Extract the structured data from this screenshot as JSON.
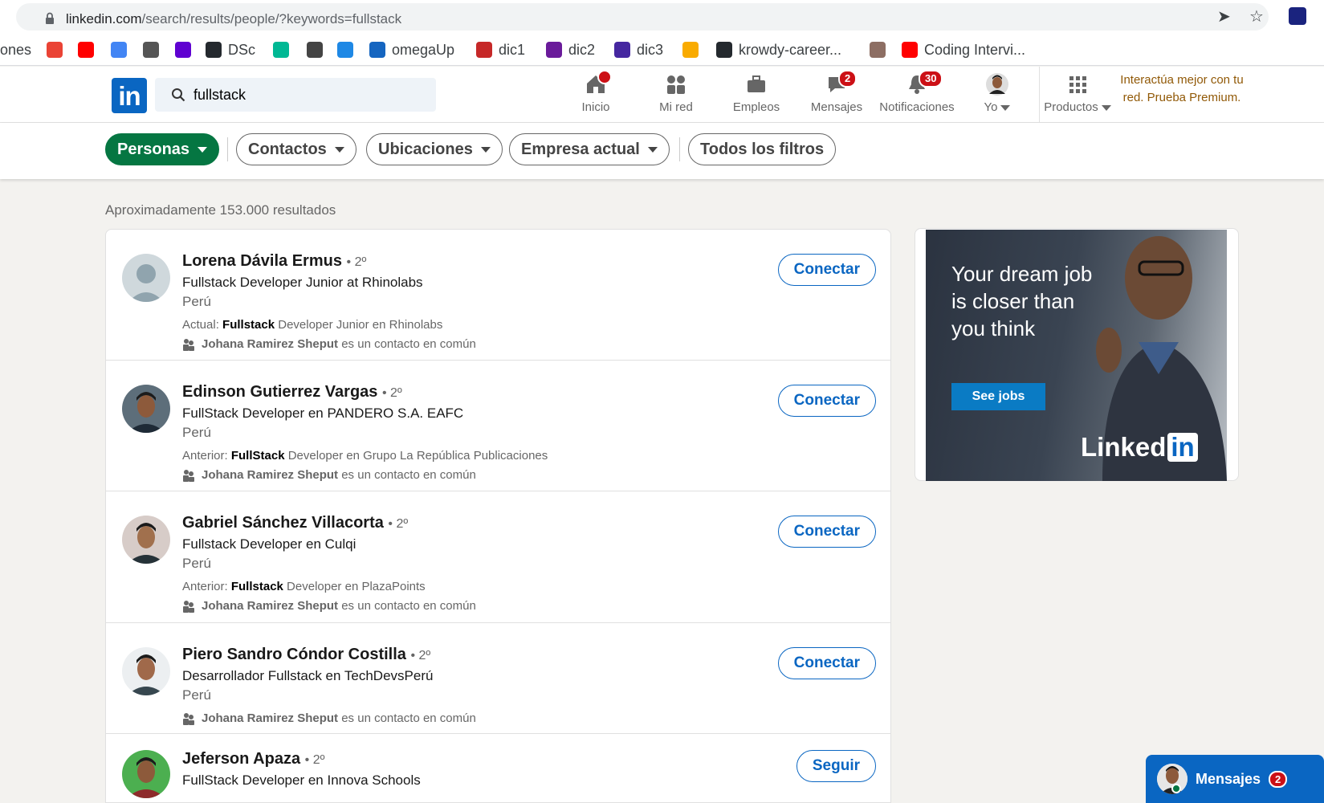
{
  "browser": {
    "url_host": "linkedin.com",
    "url_path": "/search/results/people/?keywords=fullstack",
    "bookmarks": [
      {
        "label": "ones",
        "icon": "bookmark-folder-icon",
        "color": "#ffffff"
      },
      {
        "label": "",
        "icon": "gmail-icon",
        "color": "#ea4335"
      },
      {
        "label": "",
        "icon": "youtube-icon",
        "color": "#ff0000"
      },
      {
        "label": "",
        "icon": "translate-icon",
        "color": "#4285f4"
      },
      {
        "label": "",
        "icon": "globe-icon",
        "color": "#555555"
      },
      {
        "label": "",
        "icon": "yahoo-icon",
        "color": "#5f01d1"
      },
      {
        "label": "DSc",
        "icon": "github-icon",
        "color": "#24292e"
      },
      {
        "label": "",
        "icon": "diamond-icon",
        "color": "#00b894"
      },
      {
        "label": "",
        "icon": "translate-small-icon",
        "color": "#444444"
      },
      {
        "label": "",
        "icon": "dic-icon",
        "color": "#1e88e5"
      },
      {
        "label": "omegaUp",
        "icon": "omega-icon",
        "color": "#1565c0"
      },
      {
        "label": "dic1",
        "icon": "shield-icon",
        "color": "#c62828"
      },
      {
        "label": "dic2",
        "icon": "swirl-icon",
        "color": "#6a1b9a"
      },
      {
        "label": "dic3",
        "icon": "tower-icon",
        "color": "#4527a0"
      },
      {
        "label": "",
        "icon": "classroom-icon",
        "color": "#f9ab00"
      },
      {
        "label": "krowdy-career...",
        "icon": "github-icon",
        "color": "#24292e"
      },
      {
        "label": "",
        "icon": "pe-icon",
        "color": "#8d6e63"
      },
      {
        "label": "Coding Intervi...",
        "icon": "youtube-icon",
        "color": "#ff0000"
      }
    ]
  },
  "header": {
    "search_value": "fullstack",
    "nav": [
      {
        "label": "Inicio",
        "icon": "home-icon",
        "badge": "",
        "dot": true
      },
      {
        "label": "Mi red",
        "icon": "network-icon",
        "badge": ""
      },
      {
        "label": "Empleos",
        "icon": "briefcase-icon",
        "badge": ""
      },
      {
        "label": "Mensajes",
        "icon": "chat-icon",
        "badge": "2"
      },
      {
        "label": "Notificaciones",
        "icon": "bell-icon",
        "badge": "30"
      },
      {
        "label": "Yo",
        "icon": "profile-icon",
        "badge": ""
      },
      {
        "label": "Productos",
        "icon": "grid-icon",
        "badge": ""
      }
    ],
    "premium_text": "Interactúa mejor con tu red. Prueba Premium."
  },
  "filters": {
    "pills": [
      "Personas",
      "Contactos",
      "Ubicaciones",
      "Empresa actual"
    ],
    "all_filters": "Todos los filtros"
  },
  "results": {
    "count_text": "Aproximadamente 153.000 resultados",
    "items": [
      {
        "name": "Lorena Dávila Ermus",
        "degree": "• 2º",
        "headline": "Fullstack Developer Junior at Rhinolabs",
        "location": "Perú",
        "summary_prefix": "Actual: ",
        "summary_keyword": "Fullstack",
        "summary_rest": " Developer Junior en Rhinolabs",
        "shared_name": "Johana Ramirez Sheput",
        "shared_rest": " es un contacto en común",
        "action": "Conectar"
      },
      {
        "name": "Edinson Gutierrez Vargas",
        "degree": "• 2º",
        "headline": "FullStack Developer en PANDERO S.A. EAFC",
        "location": "Perú",
        "summary_prefix": "Anterior: ",
        "summary_keyword": "FullStack",
        "summary_rest": " Developer en Grupo La República Publicaciones",
        "shared_name": "Johana Ramirez Sheput",
        "shared_rest": " es un contacto en común",
        "action": "Conectar"
      },
      {
        "name": "Gabriel Sánchez Villacorta",
        "degree": "• 2º",
        "headline": "Fullstack Developer en Culqi",
        "location": "Perú",
        "summary_prefix": "Anterior: ",
        "summary_keyword": "Fullstack",
        "summary_rest": " Developer en PlazaPoints",
        "shared_name": "Johana Ramirez Sheput",
        "shared_rest": " es un contacto en común",
        "action": "Conectar"
      },
      {
        "name": "Piero Sandro Cóndor Costilla",
        "degree": "• 2º",
        "headline": "Desarrollador Fullstack en TechDevsPerú",
        "location": "Perú",
        "shared_name": "Johana Ramirez Sheput",
        "shared_rest": " es un contacto en común",
        "action": "Conectar"
      },
      {
        "name": "Jeferson Apaza",
        "degree": "• 2º",
        "headline": "FullStack Developer en Innova Schools",
        "action": "Seguir"
      }
    ]
  },
  "ad": {
    "text": "Your dream job is closer than you think",
    "button": "See jobs",
    "logo_word": "Linked",
    "logo_in": "in"
  },
  "messaging": {
    "label": "Mensajes",
    "badge": "2"
  },
  "colors": {
    "linkedin_blue": "#0a66c2",
    "active_filter_green": "#057642",
    "badge_red": "#cc1016",
    "premium_brown": "#915907"
  }
}
